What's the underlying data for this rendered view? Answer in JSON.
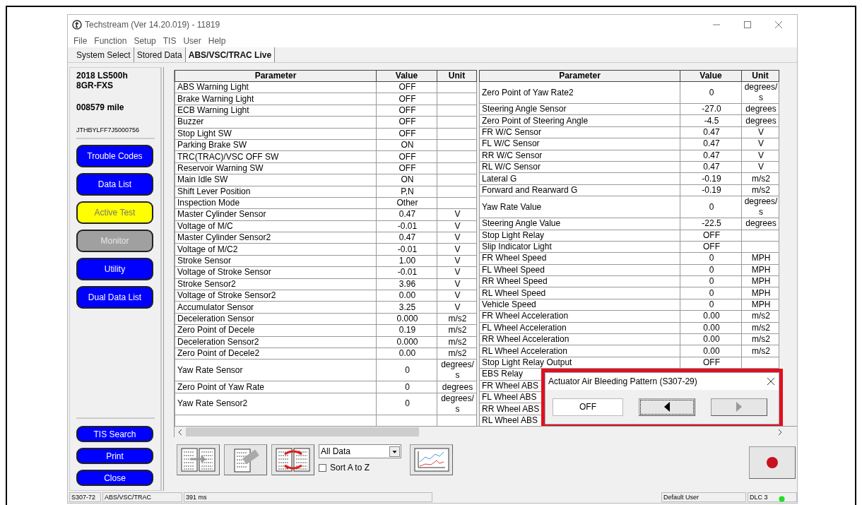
{
  "window": {
    "title": "Techstream (Ver 14.20.019) - 11819"
  },
  "menu": [
    "File",
    "Function",
    "Setup",
    "TIS",
    "User",
    "Help"
  ],
  "tabs": [
    {
      "label": "System Select",
      "selected": false
    },
    {
      "label": "Stored Data",
      "selected": false
    },
    {
      "label": "ABS/VSC/TRAC Live",
      "selected": true
    }
  ],
  "vehicle": {
    "model": "2018 LS500h",
    "engine": "8GR-FXS",
    "mileage": "008579 mile",
    "vin": "JTHBYLFF7J5000756"
  },
  "sidebar_buttons": [
    {
      "label": "Trouble Codes",
      "selected": false,
      "disabled": false
    },
    {
      "label": "Data List",
      "selected": false,
      "disabled": false
    },
    {
      "label": "Active Test",
      "selected": true,
      "disabled": false
    },
    {
      "label": "Monitor",
      "selected": false,
      "disabled": true
    },
    {
      "label": "Utility",
      "selected": false,
      "disabled": false
    },
    {
      "label": "Dual Data List",
      "selected": false,
      "disabled": false
    }
  ],
  "sidebar_bottom_buttons": [
    "TIS Search",
    "Print",
    "Close"
  ],
  "tables": [
    {
      "columns": [
        "Parameter",
        "Value",
        "Unit"
      ],
      "rows": [
        {
          "parameter": "ABS Warning Light",
          "value": "OFF"
        },
        {
          "parameter": "Brake Warning Light",
          "value": "OFF"
        },
        {
          "parameter": "ECB Warning Light",
          "value": "OFF"
        },
        {
          "parameter": "Buzzer",
          "value": "OFF"
        },
        {
          "parameter": "Stop Light SW",
          "value": "OFF"
        },
        {
          "parameter": "Parking Brake SW",
          "value": "ON"
        },
        {
          "parameter": "TRC(TRAC)/VSC OFF SW",
          "value": "OFF"
        },
        {
          "parameter": "Reservoir Warning SW",
          "value": "OFF"
        },
        {
          "parameter": "Main Idle SW",
          "value": "ON"
        },
        {
          "parameter": "Shift Lever Position",
          "value": "P,N"
        },
        {
          "parameter": "Inspection Mode",
          "value": "Other"
        },
        {
          "parameter": "Master Cylinder Sensor",
          "value": "0.47",
          "unit": "V"
        },
        {
          "parameter": "Voltage of M/C",
          "value": "-0.01",
          "unit": "V"
        },
        {
          "parameter": "Master Cylinder Sensor2",
          "value": "0.47",
          "unit": "V"
        },
        {
          "parameter": "Voltage of M/C2",
          "value": "-0.01",
          "unit": "V"
        },
        {
          "parameter": "Stroke Sensor",
          "value": "1.00",
          "unit": "V"
        },
        {
          "parameter": "Voltage of Stroke Sensor",
          "value": "-0.01",
          "unit": "V"
        },
        {
          "parameter": "Stroke Sensor2",
          "value": "3.96",
          "unit": "V"
        },
        {
          "parameter": "Voltage of Stroke Sensor2",
          "value": "0.00",
          "unit": "V"
        },
        {
          "parameter": "Accumulator Sensor",
          "value": "3.25",
          "unit": "V"
        },
        {
          "parameter": "Deceleration Sensor",
          "value": "0.000",
          "unit": "m/s2"
        },
        {
          "parameter": "Zero Point of Decele",
          "value": "0.19",
          "unit": "m/s2"
        },
        {
          "parameter": "Deceleration Sensor2",
          "value": "0.000",
          "unit": "m/s2"
        },
        {
          "parameter": "Zero Point of Decele2",
          "value": "0.00",
          "unit": "m/s2"
        },
        {
          "parameter": "Yaw Rate Sensor",
          "value": "0",
          "unit": "degrees/s"
        },
        {
          "parameter": "Zero Point of Yaw Rate",
          "value": "0",
          "unit": "degrees"
        },
        {
          "parameter": "Yaw Rate Sensor2",
          "value": "0",
          "unit": "degrees/s"
        },
        {}
      ]
    },
    {
      "columns": [
        "Parameter",
        "Value",
        "Unit"
      ],
      "rows": [
        {
          "parameter": "Zero Point of Yaw Rate2",
          "value": "0",
          "unit": "degrees/s"
        },
        {
          "parameter": "Steering Angle Sensor",
          "value": "-27.0",
          "unit": "degrees"
        },
        {
          "parameter": "Zero Point of Steering Angle",
          "value": "-4.5",
          "unit": "degrees"
        },
        {
          "parameter": "FR W/C Sensor",
          "value": "0.47",
          "unit": "V"
        },
        {
          "parameter": "FL W/C Sensor",
          "value": "0.47",
          "unit": "V"
        },
        {
          "parameter": "RR W/C Sensor",
          "value": "0.47",
          "unit": "V"
        },
        {
          "parameter": "RL W/C Sensor",
          "value": "0.47",
          "unit": "V"
        },
        {
          "parameter": "Lateral G",
          "value": "-0.19",
          "unit": "m/s2"
        },
        {
          "parameter": "Forward and Rearward G",
          "value": "-0.19",
          "unit": "m/s2"
        },
        {
          "parameter": "Yaw Rate Value",
          "value": "0",
          "unit": "degrees/s"
        },
        {
          "parameter": "Steering Angle Value",
          "value": "-22.5",
          "unit": "degrees"
        },
        {
          "parameter": "Stop Light Relay",
          "value": "OFF"
        },
        {
          "parameter": "Slip Indicator Light",
          "value": "OFF"
        },
        {
          "parameter": "FR Wheel Speed",
          "value": "0",
          "unit": "MPH"
        },
        {
          "parameter": "FL Wheel Speed",
          "value": "0",
          "unit": "MPH"
        },
        {
          "parameter": "RR Wheel Speed",
          "value": "0",
          "unit": "MPH"
        },
        {
          "parameter": "RL Wheel Speed",
          "value": "0",
          "unit": "MPH"
        },
        {
          "parameter": "Vehicle Speed",
          "value": "0",
          "unit": "MPH"
        },
        {
          "parameter": "FR Wheel Acceleration",
          "value": "0.00",
          "unit": "m/s2"
        },
        {
          "parameter": "FL Wheel Acceleration",
          "value": "0.00",
          "unit": "m/s2"
        },
        {
          "parameter": "RR Wheel Acceleration",
          "value": "0.00",
          "unit": "m/s2"
        },
        {
          "parameter": "RL Wheel Acceleration",
          "value": "0.00",
          "unit": "m/s2"
        },
        {
          "parameter": "Stop Light Relay Output",
          "value": "OFF"
        },
        {
          "parameter": "EBS Relay"
        },
        {
          "parameter": "FR Wheel ABS"
        },
        {
          "parameter": "FL Wheel ABS"
        },
        {
          "parameter": "RR Wheel ABS"
        },
        {
          "parameter": "RL Wheel ABS"
        }
      ]
    }
  ],
  "toolbar": {
    "filter": {
      "value": "All Data"
    },
    "sort": {
      "label": "Sort A to Z",
      "checked": false
    }
  },
  "dialog": {
    "title": "Actuator Air Bleeding Pattern (S307-29)",
    "value": "OFF",
    "previous": {
      "disabled": false
    },
    "next": {
      "disabled": true
    }
  },
  "status_bar": {
    "left": [
      "S307-72",
      "ABS/VSC/TRAC",
      "391 ms"
    ],
    "right": [
      "Default User",
      "DLC 3"
    ],
    "connected": true
  }
}
